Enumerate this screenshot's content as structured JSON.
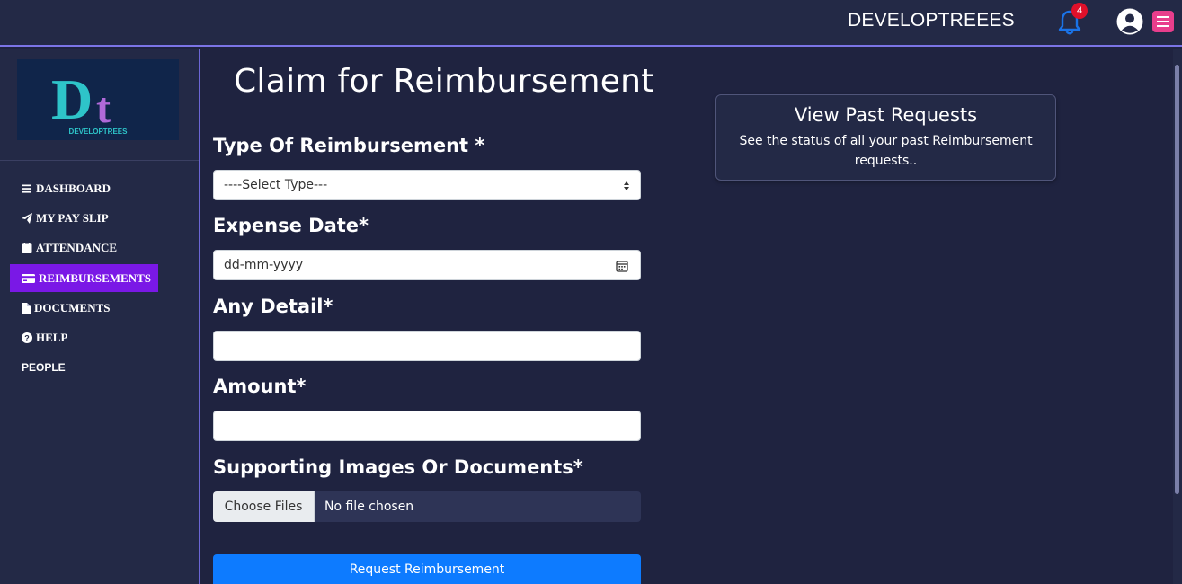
{
  "header": {
    "brand": "DEVELOPTREEES",
    "notification_count": "4"
  },
  "sidebar": {
    "logo_text": "DEVELOPTREES",
    "items": [
      {
        "label": "DASHBOARD",
        "icon": "bars-icon"
      },
      {
        "label": "MY PAY SLIP",
        "icon": "paper-plane-icon"
      },
      {
        "label": "ATTENDANCE",
        "icon": "calendar-icon"
      },
      {
        "label": "REIMBURSEMENTS",
        "icon": "credit-card-icon",
        "active": true
      },
      {
        "label": "DOCUMENTS",
        "icon": "file-icon"
      },
      {
        "label": "HELP",
        "icon": "question-circle-icon"
      },
      {
        "label": "PEOPLE",
        "icon": ""
      }
    ]
  },
  "main": {
    "title": "Claim for Reimbursement",
    "type_label": "Type Of Reimbursement *",
    "type_select": "----Select Type---",
    "date_label": "Expense Date*",
    "date_placeholder": "dd-mm-yyyy",
    "detail_label": "Any Detail*",
    "detail_value": "",
    "amount_label": "Amount*",
    "amount_value": "",
    "docs_label": "Supporting Images Or Documents*",
    "choose_files": "Choose Files",
    "file_status": "No file chosen",
    "submit_label": "Request Reimbursement"
  },
  "past_requests": {
    "title": "View Past Requests",
    "description": "See the status of all your past Reimbursement requests.."
  },
  "colors": {
    "background": "#1f2340",
    "panel": "#232946",
    "active_nav": "#7a18e6",
    "primary_button": "#0d7bff",
    "menu_button": "#e83e8c",
    "bell": "#1a73e8",
    "badge": "#e0102a"
  }
}
